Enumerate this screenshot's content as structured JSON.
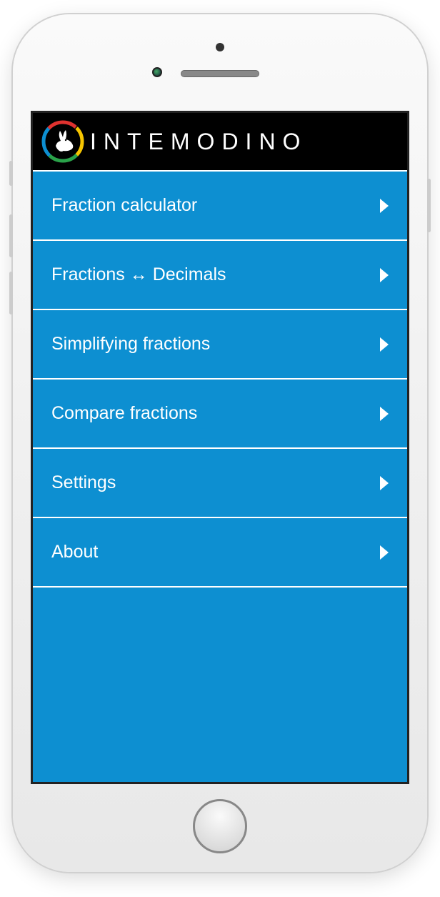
{
  "header": {
    "brand": "INTEMODINO"
  },
  "menu": {
    "items": [
      {
        "label": "Fraction calculator"
      },
      {
        "label": "Fractions ↔ Decimals"
      },
      {
        "label": "Simplifying fractions"
      },
      {
        "label": "Compare fractions"
      },
      {
        "label": "Settings"
      },
      {
        "label": "About"
      }
    ]
  }
}
